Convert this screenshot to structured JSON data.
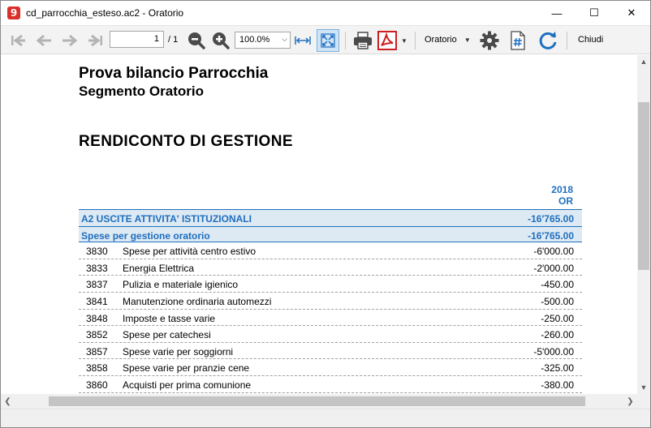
{
  "window": {
    "title": "cd_parrocchia_esteso.ac2 - Oratorio",
    "app_icon_glyph": "9",
    "minimize_glyph": "—",
    "maximize_glyph": "☐",
    "close_glyph": "✕"
  },
  "toolbar": {
    "page_value": "1",
    "page_total": "/ 1",
    "zoom_value": "100.0%",
    "view_name": "Oratorio",
    "close_label": "Chiudi",
    "icons": [
      "first-page-icon",
      "prev-page-icon",
      "next-page-icon",
      "last-page-icon",
      "zoom-out-icon",
      "zoom-in-icon",
      "fit-width-icon",
      "fit-page-icon",
      "print-icon",
      "pdf-icon",
      "settings-icon",
      "hash-icon",
      "refresh-icon"
    ],
    "accent": "#1f6fbf"
  },
  "report": {
    "title": "Prova bilancio Parrocchia",
    "subtitle": "Segmento Oratorio",
    "heading": "RENDICONTO DI GESTIONE",
    "column_year": "2018",
    "column_segment": "OR",
    "group": {
      "label": "A2 USCITE ATTIVITA' ISTITUZIONALI",
      "amount": "-16'765.00"
    },
    "subgroup": {
      "label": "Spese per gestione oratorio",
      "amount": "-16'765.00"
    },
    "rows": [
      {
        "code": "3830",
        "desc": "Spese per attività centro estivo",
        "amount": "-6'000.00"
      },
      {
        "code": "3833",
        "desc": "Energia Elettrica",
        "amount": "-2'000.00"
      },
      {
        "code": "3837",
        "desc": "Pulizia e materiale igienico",
        "amount": "-450.00"
      },
      {
        "code": "3841",
        "desc": "Manutenzione ordinaria automezzi",
        "amount": "-500.00"
      },
      {
        "code": "3848",
        "desc": "Imposte e tasse varie",
        "amount": "-250.00"
      },
      {
        "code": "3852",
        "desc": "Spese per catechesi",
        "amount": "-260.00"
      },
      {
        "code": "3857",
        "desc": "Spese varie per soggiorni",
        "amount": "-5'000.00"
      },
      {
        "code": "3858",
        "desc": "Spese varie per pranzie cene",
        "amount": "-325.00"
      },
      {
        "code": "3860",
        "desc": "Acquisti per prima comunione",
        "amount": "-380.00"
      }
    ]
  }
}
